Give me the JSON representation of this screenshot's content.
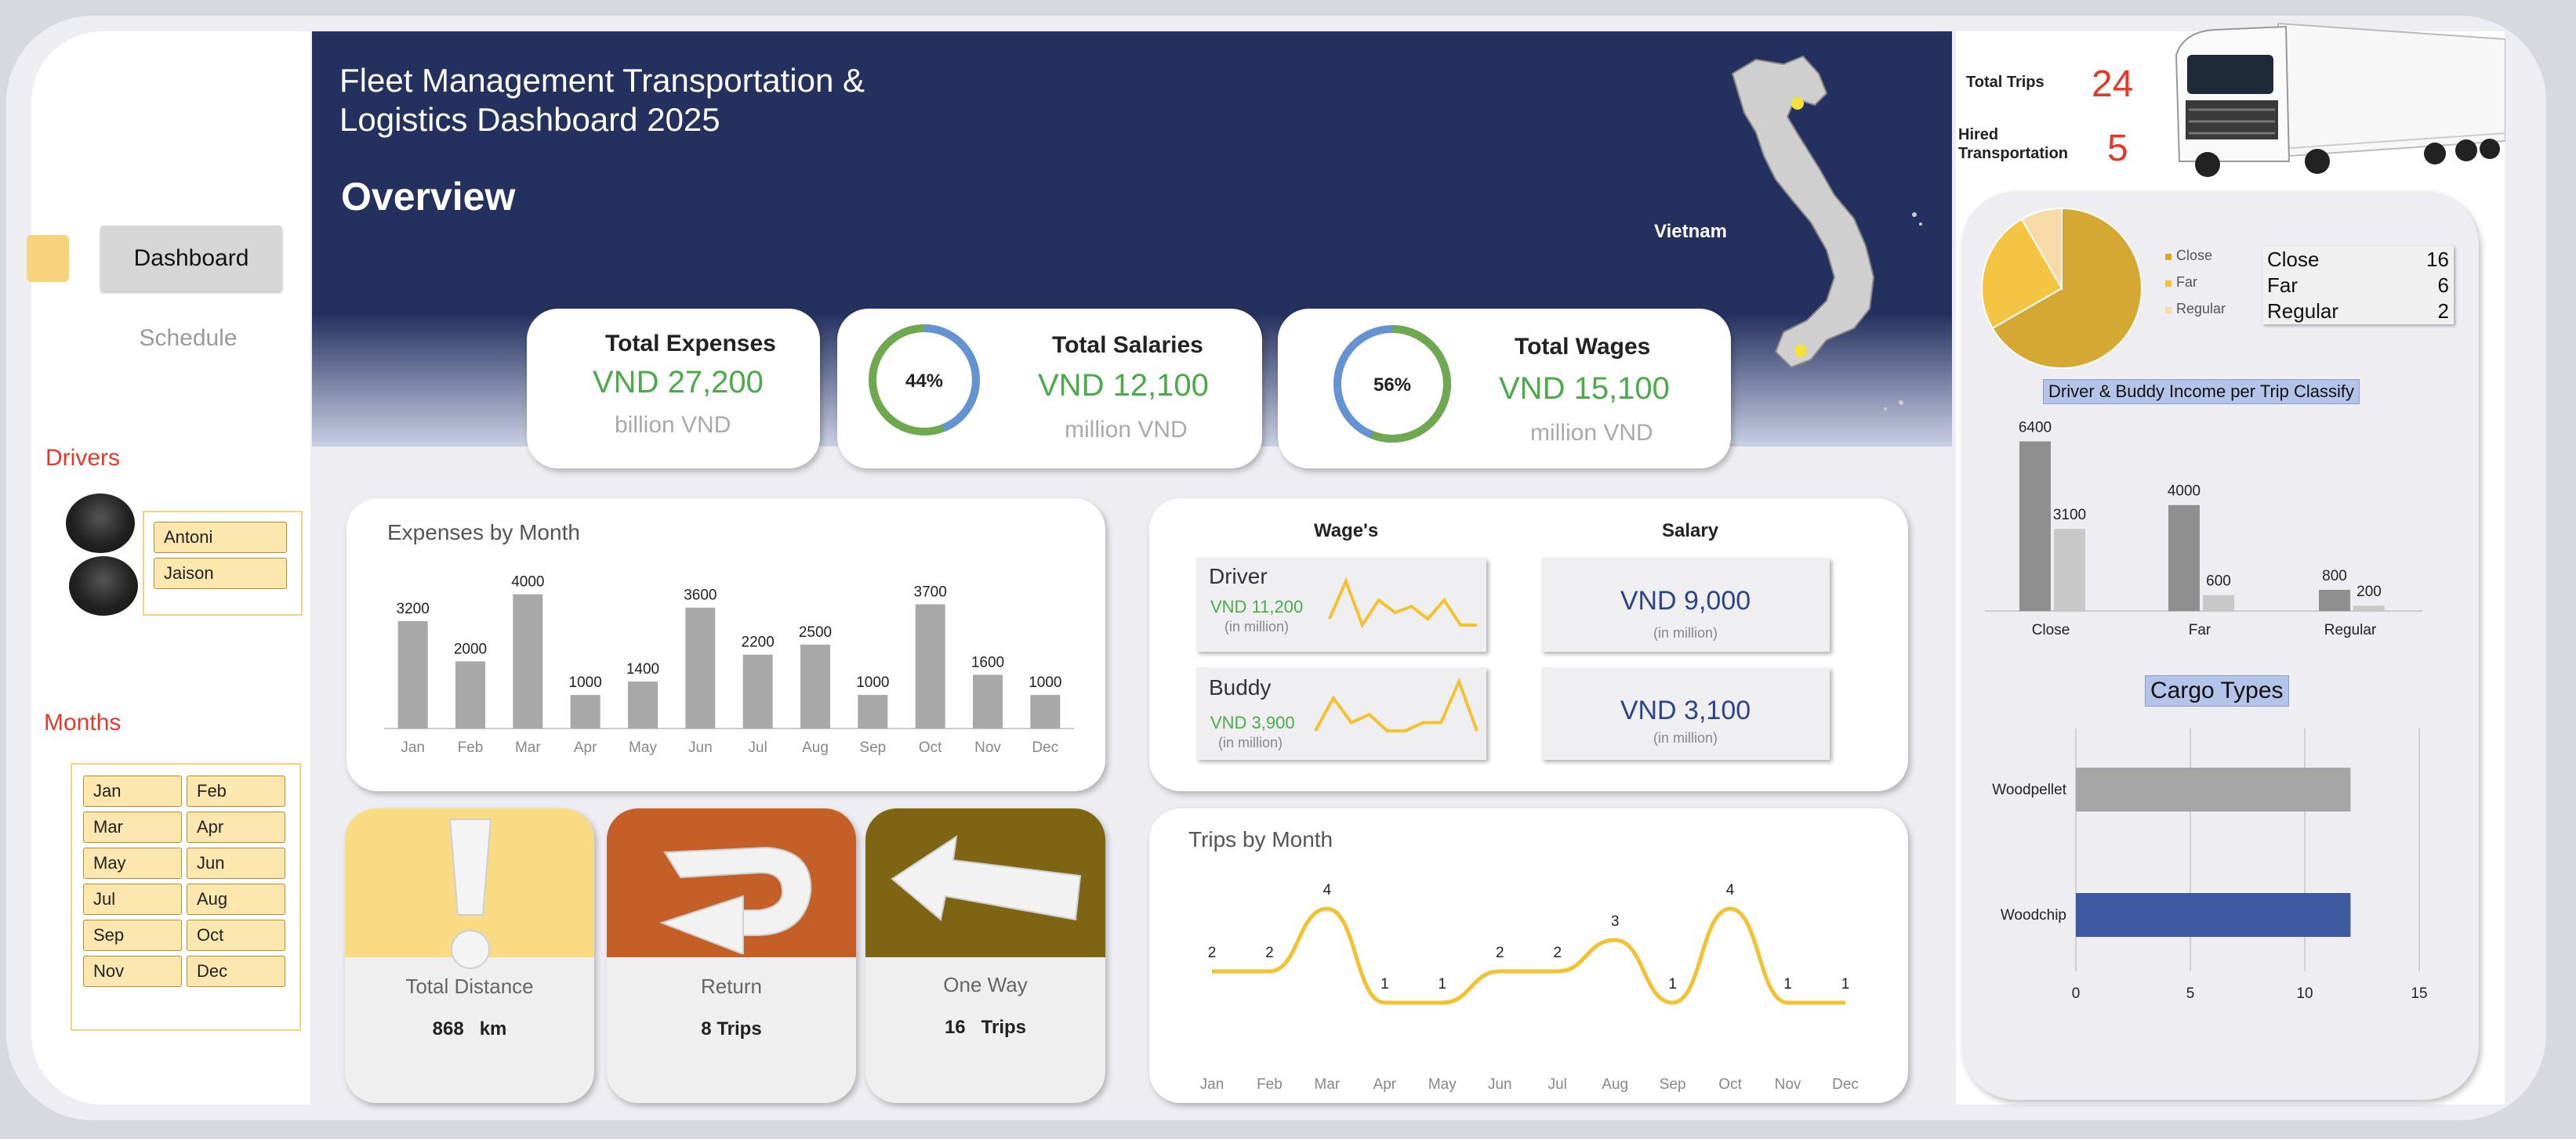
{
  "header": {
    "title_line1": "Fleet Management Transportation &",
    "title_line2": "Logistics Dashboard 2025",
    "section": "Overview",
    "map_label": "Vietnam"
  },
  "nav": {
    "dashboard_label": "Dashboard",
    "schedule_label": "Schedule"
  },
  "drivers": {
    "label": "Drivers",
    "names": [
      "Antoni",
      "Jaison"
    ]
  },
  "months_slicer": {
    "label": "Months",
    "items": [
      "Jan",
      "Feb",
      "Mar",
      "Apr",
      "May",
      "Jun",
      "Jul",
      "Aug",
      "Sep",
      "Oct",
      "Nov",
      "Dec"
    ]
  },
  "kpis": {
    "expenses": {
      "title": "Total Expenses",
      "value": "VND 27,200",
      "unit": "billion VND"
    },
    "salaries": {
      "title": "Total Salaries",
      "value": "VND 12,100",
      "unit": "million VND",
      "pct_label": "44%",
      "pct": 0.44
    },
    "wages": {
      "title": "Total Wages",
      "value": "VND 15,100",
      "unit": "million VND",
      "pct_label": "56%",
      "pct": 0.56
    }
  },
  "wage_panel": {
    "wage_header": "Wage's",
    "salary_header": "Salary",
    "driver": {
      "label": "Driver",
      "value": "VND 11,200",
      "unit": "(in million)"
    },
    "buddy": {
      "label": "Buddy",
      "value": "VND 3,900",
      "unit": "(in million)"
    },
    "salary_driver": {
      "value": "VND 9,000",
      "unit": "(in million)"
    },
    "salary_buddy": {
      "value": "VND 3,100",
      "unit": "(in million)"
    }
  },
  "tiles": {
    "distance": {
      "title": "Total Distance",
      "value": "868",
      "unit": "km"
    },
    "return": {
      "title": "Return",
      "value": "8",
      "unit": "Trips"
    },
    "oneway": {
      "title": "One Way",
      "value": "16",
      "unit": "Trips"
    }
  },
  "totals": {
    "trips_label": "Total Trips",
    "trips_value": "24",
    "hired_label_line1": "Hired",
    "hired_label_line2": "Transportation",
    "hired_value": "5"
  },
  "trip_class_table": [
    {
      "label": "Close",
      "value": "16"
    },
    {
      "label": "Far",
      "value": "6"
    },
    {
      "label": "Regular",
      "value": "2"
    }
  ],
  "colors": {
    "navy": "#24315f",
    "green": "#4caa4a",
    "red": "#e23a2a",
    "gold": "#d4a833",
    "line_yellow": "#f2c232",
    "bar_gray": "#a8a8a8",
    "cargo_blue": "#3d5aa0"
  },
  "chart_data": [
    {
      "type": "bar",
      "title": "Expenses by Month",
      "categories": [
        "Jan",
        "Feb",
        "Mar",
        "Apr",
        "May",
        "Jun",
        "Jul",
        "Aug",
        "Sep",
        "Oct",
        "Nov",
        "Dec"
      ],
      "values": [
        3200,
        2000,
        4000,
        1000,
        1400,
        3600,
        2200,
        2500,
        1000,
        3700,
        1600,
        1000
      ],
      "ylim": [
        0,
        4200
      ]
    },
    {
      "type": "line",
      "title": "Trips by Month",
      "x": [
        "Jan",
        "Feb",
        "Mar",
        "Apr",
        "May",
        "Jun",
        "Jul",
        "Aug",
        "Sep",
        "Oct",
        "Nov",
        "Dec"
      ],
      "values": [
        2,
        2,
        4,
        1,
        1,
        2,
        2,
        3,
        1,
        4,
        1,
        1
      ],
      "ylim": [
        0,
        5
      ]
    },
    {
      "type": "pie",
      "labels": [
        "Close",
        "Far",
        "Regular"
      ],
      "values": [
        16,
        6,
        2
      ],
      "legend": "right"
    },
    {
      "type": "bar",
      "title": "Driver & Buddy Income per Trip Classify",
      "categories": [
        "Close",
        "Far",
        "Regular"
      ],
      "series": [
        {
          "values": [
            6400,
            4000,
            800
          ]
        },
        {
          "values": [
            3100,
            600,
            200
          ]
        }
      ],
      "ylim": [
        0,
        6800
      ]
    },
    {
      "type": "bar",
      "title": "Cargo Types",
      "orientation": "horizontal",
      "categories": [
        "Woodpellet",
        "Woodchip"
      ],
      "values": [
        12,
        12
      ],
      "xlim": [
        0,
        15
      ],
      "x_ticks": [
        "0",
        "5",
        "10",
        "15"
      ],
      "grid": true
    },
    {
      "type": "line",
      "name": "Driver",
      "values": [
        3,
        9,
        2,
        6,
        4,
        5,
        3,
        6,
        2,
        2
      ]
    },
    {
      "type": "line",
      "name": "Buddy",
      "values": [
        2,
        6,
        3,
        4,
        2,
        2,
        3,
        3,
        8,
        2
      ]
    }
  ]
}
